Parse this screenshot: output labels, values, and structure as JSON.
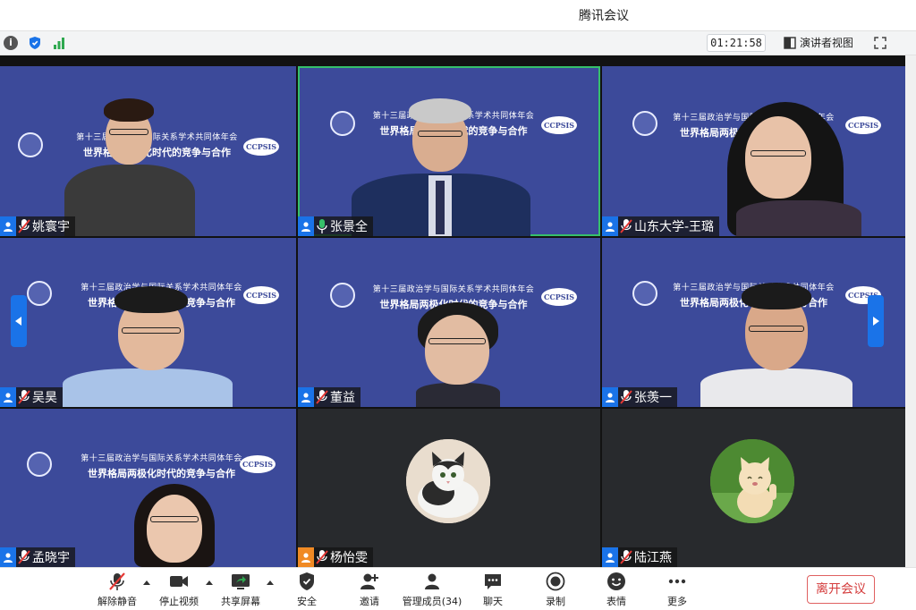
{
  "window": {
    "title": "腾讯会议"
  },
  "topbar": {
    "timer": "01:21:58",
    "presenter_view": "演讲者视图"
  },
  "banner": {
    "line1": "第十三届政治学与国际关系学术共同体年会",
    "line2": "世界格局两极化时代的竞争与合作",
    "logo": "CCPSIS"
  },
  "participants": [
    {
      "name": "姚寰宇"
    },
    {
      "name": "张景全"
    },
    {
      "name": "山东大学-王璐"
    },
    {
      "name": "吴昊"
    },
    {
      "name": "董益"
    },
    {
      "name": "张羡一"
    },
    {
      "name": "孟晓宇"
    },
    {
      "name": "杨怡雯"
    },
    {
      "name": "陆江燕"
    }
  ],
  "toolbar": {
    "unmute": "解除静音",
    "stop_video": "停止视频",
    "share_screen": "共享屏幕",
    "security": "安全",
    "invite": "邀请",
    "manage_members": "管理成员(34)",
    "chat": "聊天",
    "record": "录制",
    "reactions": "表情",
    "more": "更多",
    "leave": "离开会议"
  },
  "colors": {
    "accent": "#1a73e8",
    "active_speaker": "#36c06a",
    "leave": "#d43c3c",
    "video_bg": "#3c4a9a"
  }
}
